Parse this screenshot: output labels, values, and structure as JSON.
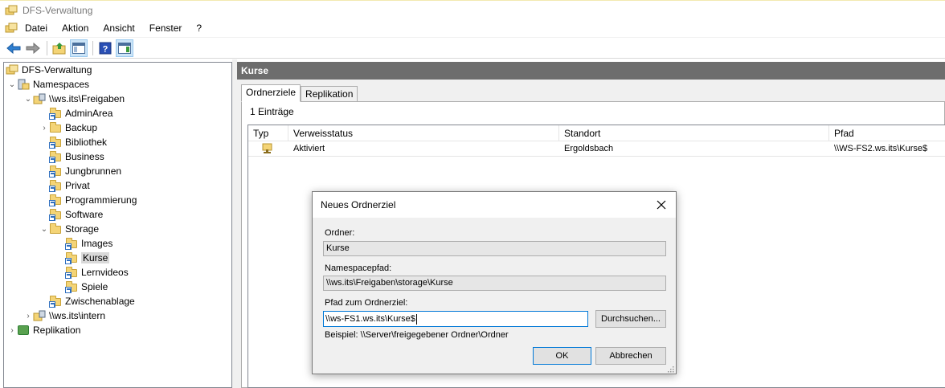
{
  "window": {
    "title": "DFS-Verwaltung"
  },
  "menu": {
    "items": [
      "Datei",
      "Aktion",
      "Ansicht",
      "Fenster",
      "?"
    ]
  },
  "toolbar": {
    "icons": [
      "back-icon",
      "forward-icon",
      "up-folder-icon",
      "show-hide-tree-icon",
      "help-icon",
      "action-pane-icon"
    ]
  },
  "tree": {
    "items": [
      {
        "label": "DFS-Verwaltung",
        "icon": "dfs-management-icon"
      },
      {
        "label": "Namespaces",
        "icon": "namespaces-icon"
      },
      {
        "label": "\\\\ws.its\\Freigaben",
        "icon": "namespace-icon"
      },
      {
        "label": "AdminArea",
        "icon": "shared-folder-icon"
      },
      {
        "label": "Backup",
        "icon": "folder-icon"
      },
      {
        "label": "Bibliothek",
        "icon": "shared-folder-icon"
      },
      {
        "label": "Business",
        "icon": "shared-folder-icon"
      },
      {
        "label": "Jungbrunnen",
        "icon": "shared-folder-icon"
      },
      {
        "label": "Privat",
        "icon": "shared-folder-icon"
      },
      {
        "label": "Programmierung",
        "icon": "shared-folder-icon"
      },
      {
        "label": "Software",
        "icon": "shared-folder-icon"
      },
      {
        "label": "Storage",
        "icon": "folder-icon"
      },
      {
        "label": "Images",
        "icon": "shared-folder-icon"
      },
      {
        "label": "Kurse",
        "icon": "shared-folder-icon"
      },
      {
        "label": "Lernvideos",
        "icon": "shared-folder-icon"
      },
      {
        "label": "Spiele",
        "icon": "shared-folder-icon"
      },
      {
        "label": "Zwischenablage",
        "icon": "shared-folder-icon"
      },
      {
        "label": "\\\\ws.its\\intern",
        "icon": "namespace-icon"
      },
      {
        "label": "Replikation",
        "icon": "replication-icon"
      }
    ],
    "selected": "Kurse"
  },
  "detail": {
    "header": "Kurse",
    "tabs": [
      "Ordnerziele",
      "Replikation"
    ],
    "active_tab": "Ordnerziele",
    "count": "1 Einträge",
    "columns": [
      "Typ",
      "Verweisstatus",
      "Standort",
      "Pfad"
    ],
    "rows": [
      {
        "type_icon": "folder-target-icon",
        "status": "Aktiviert",
        "location": "Ergoldsbach",
        "path": "\\\\WS-FS2.ws.its\\Kurse$"
      }
    ]
  },
  "dialog": {
    "title": "Neues Ordnerziel",
    "folder_label": "Ordner:",
    "folder_value": "Kurse",
    "namespace_label": "Namespacepfad:",
    "namespace_value": "\\\\ws.its\\Freigaben\\storage\\Kurse",
    "target_label": "Pfad zum Ordnerziel:",
    "target_value": "\\\\ws-FS1.ws.its\\Kurse$",
    "browse_label": "Durchsuchen...",
    "example": "Beispiel: \\\\Server\\freigegebener Ordner\\Ordner",
    "ok_label": "OK",
    "cancel_label": "Abbrechen"
  },
  "colors": {
    "header_bg": "#6d6d6d",
    "accent": "#0078d7",
    "folder": "#f4d476"
  }
}
